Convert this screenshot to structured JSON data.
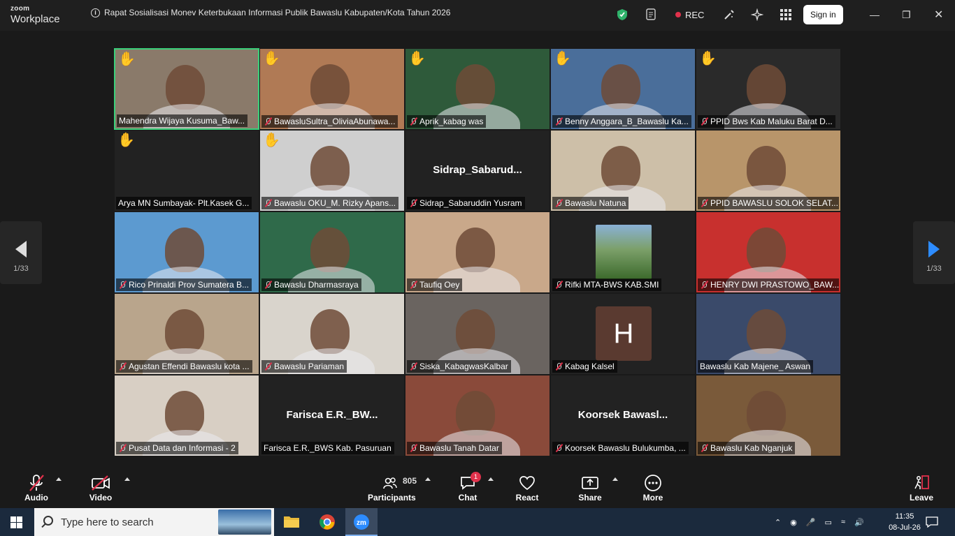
{
  "app": {
    "brand_top": "zoom",
    "brand_bottom": "Workplace"
  },
  "meeting": {
    "title": "Rapat Sosialisasi Monev Keterbukaan Informasi Publik Bawaslu Kabupaten/Kota Tahun 2026"
  },
  "titlebar": {
    "rec_label": "REC",
    "signin_label": "Sign in",
    "rec_color": "#e0314b",
    "shield_color": "#2fb36b"
  },
  "pager": {
    "left_label": "1/33",
    "right_label": "1/33",
    "accent": "#2d8cff"
  },
  "participants": [
    {
      "name": "Mahendra Wijaya Kusuma_Baw...",
      "hand": true,
      "muted": false,
      "active": true,
      "bg": "#8a7a6a"
    },
    {
      "name": "BawasluSultra_OliviaAbunawa...",
      "hand": true,
      "muted": true,
      "bg": "#b07a55"
    },
    {
      "name": "Aprik_kabag was",
      "hand": true,
      "muted": true,
      "bg": "#2e5a3a"
    },
    {
      "name": "Benny Anggara_B_Bawaslu Ka...",
      "hand": true,
      "muted": true,
      "bg": "#4a6e9a"
    },
    {
      "name": "PPID Bws Kab Maluku Barat D...",
      "hand": true,
      "muted": true,
      "bg": "#2a2a2a"
    },
    {
      "name": "Arya MN Sumbayak- Plt.Kasek G...",
      "hand": true,
      "muted": false,
      "bg": "#222222"
    },
    {
      "name": "Bawaslu OKU_M. Rizky Apans...",
      "hand": true,
      "muted": true,
      "bg": "#cfcfcf"
    },
    {
      "name": "Sidrap_Sabaruddin Yusram",
      "hand": false,
      "muted": true,
      "bg": "#222222",
      "display": "Sidrap_Sabarud..."
    },
    {
      "name": "Bawaslu Natuna",
      "hand": false,
      "muted": true,
      "bg": "#cdbfa8"
    },
    {
      "name": "PPID BAWASLU SOLOK SELAT...",
      "hand": false,
      "muted": true,
      "bg": "#b8956a"
    },
    {
      "name": "Rico Prinaldi Prov Sumatera B...",
      "hand": false,
      "muted": true,
      "bg": "#5c9ad0"
    },
    {
      "name": "Bawaslu Dharmasraya",
      "hand": false,
      "muted": true,
      "bg": "#2f6a4a"
    },
    {
      "name": "Taufiq Oey",
      "hand": false,
      "muted": true,
      "bg": "#c9a88a"
    },
    {
      "name": "Rifki MTA-BWS KAB.SMI",
      "hand": false,
      "muted": true,
      "bg": "#222222"
    },
    {
      "name": "HENRY DWI PRASTOWO_BAW...",
      "hand": false,
      "muted": true,
      "bg": "#c8302e"
    },
    {
      "name": "Agustan Effendi Bawaslu kota ...",
      "hand": false,
      "muted": true,
      "bg": "#b9a58c"
    },
    {
      "name": "Bawaslu Pariaman",
      "hand": false,
      "muted": true,
      "bg": "#d9d4cc"
    },
    {
      "name": "Siska_KabagwasKalbar",
      "hand": false,
      "muted": true,
      "bg": "#6a6460"
    },
    {
      "name": "Kabag Kalsel",
      "hand": false,
      "muted": true,
      "bg": "#222222",
      "avatar": "H"
    },
    {
      "name": "Bawaslu Kab Majene_ Aswan",
      "hand": false,
      "muted": false,
      "bg": "#3a4a6a"
    },
    {
      "name": "Pusat Data dan Informasi - 2",
      "hand": false,
      "muted": true,
      "bg": "#d8cfc4"
    },
    {
      "name": "Farisca E.R._BWS Kab. Pasuruan",
      "hand": false,
      "muted": false,
      "bg": "#222222",
      "display": "Farisca E.R._BW..."
    },
    {
      "name": "Bawaslu Tanah Datar",
      "hand": false,
      "muted": true,
      "bg": "#8a4a3a"
    },
    {
      "name": "Koorsek Bawaslu Bulukumba, ...",
      "hand": false,
      "muted": true,
      "bg": "#222222",
      "display": "Koorsek Bawasl..."
    },
    {
      "name": "Bawaslu Kab Nganjuk",
      "hand": false,
      "muted": true,
      "bg": "#7a5a3a"
    }
  ],
  "toolbar": {
    "audio_label": "Audio",
    "video_label": "Video",
    "participants_label": "Participants",
    "participants_count": "805",
    "chat_label": "Chat",
    "chat_badge": "1",
    "react_label": "React",
    "share_label": "Share",
    "more_label": "More",
    "leave_label": "Leave",
    "leave_color": "#e0314b"
  },
  "taskbar": {
    "search_placeholder": "Type here to search",
    "time": "11:35",
    "date": "08-Jul-26"
  }
}
